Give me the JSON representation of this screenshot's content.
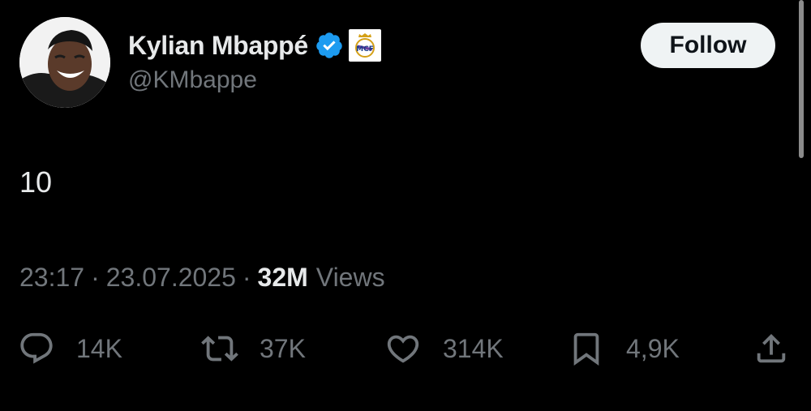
{
  "user": {
    "name": "Kylian Mbappé",
    "handle": "@KMbappe",
    "verified": true
  },
  "follow_button": {
    "label": "Follow"
  },
  "tweet": {
    "text": "10",
    "time": "23:17",
    "date": "23.07.2025",
    "separator": "·",
    "views_count": "32M",
    "views_label": "Views"
  },
  "actions": {
    "replies": "14K",
    "reposts": "37K",
    "likes": "314K",
    "bookmarks": "4,9K"
  },
  "icons": {
    "reply": "speech-bubble-icon",
    "repost": "repost-icon",
    "like": "heart-icon",
    "bookmark": "bookmark-icon",
    "share": "share-icon"
  },
  "colors": {
    "background": "#000000",
    "primary_text": "#e7e9ea",
    "secondary_text": "#71767b",
    "verified_blue": "#1d9bf0",
    "follow_bg": "#eff3f4"
  }
}
